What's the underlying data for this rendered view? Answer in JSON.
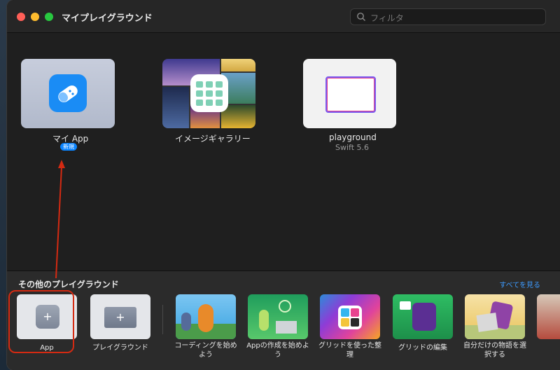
{
  "window": {
    "title": "マイプレイグラウンド"
  },
  "search": {
    "placeholder": "フィルタ"
  },
  "my_playgrounds": [
    {
      "label": "マイ App",
      "badge": "新規"
    },
    {
      "label": "イメージギャラリー"
    },
    {
      "label": "playground",
      "sublabel": "Swift 5.6"
    }
  ],
  "other": {
    "title": "その他のプレイグラウンド",
    "see_all": "すべてを見る",
    "items": [
      {
        "label": "App"
      },
      {
        "label": "プレイグラウンド"
      },
      {
        "label": "コーディングを始め\nよう"
      },
      {
        "label": "Appの作成を始めよ\nう"
      },
      {
        "label": "グリッドを使った整\n理"
      },
      {
        "label": "グリッドの編集"
      },
      {
        "label": "自分だけの物語を選\n択する"
      }
    ]
  },
  "colors": {
    "accent": "#0a84ff",
    "annotation": "#d42a12",
    "window_bg": "#1f1f1f",
    "shelf_bg": "#2b2b2b"
  }
}
